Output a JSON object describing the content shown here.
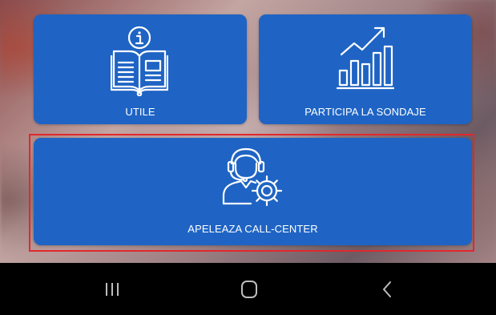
{
  "tiles": {
    "utile": {
      "label": "UTILE",
      "icon": "info-book-icon"
    },
    "sondaje": {
      "label": "PARTICIPA LA SONDAJE",
      "icon": "bar-chart-growth-icon"
    },
    "call_center": {
      "label": "APELEAZA CALL-CENTER",
      "icon": "operator-headset-gear-icon"
    }
  },
  "colors": {
    "tile_blue": "#1f64c4",
    "highlight_red": "#e0282e",
    "navbar_black": "#000000"
  },
  "navbar": {
    "recent": {
      "icon": "recent-apps-icon"
    },
    "home": {
      "icon": "home-icon"
    },
    "back": {
      "icon": "back-icon"
    }
  }
}
